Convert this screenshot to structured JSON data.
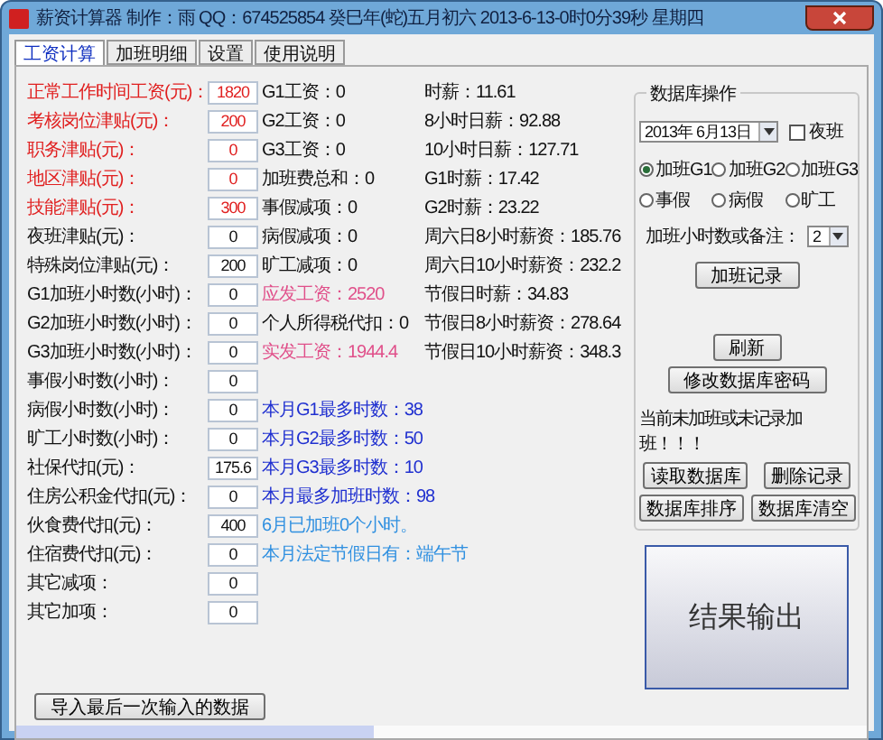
{
  "window": {
    "title": "薪资计算器  制作：雨 QQ：674525854    癸巳年(蛇)五月初六 2013-6-13-0时0分39秒    星期四"
  },
  "tabs": [
    {
      "label": "工资计算",
      "selected": true
    },
    {
      "label": "加班明细",
      "selected": false
    },
    {
      "label": "设置",
      "selected": false
    },
    {
      "label": "使用说明",
      "selected": false
    }
  ],
  "inputs": [
    {
      "label": "正常工作时间工资(元)：",
      "value": "1820",
      "kind": "required"
    },
    {
      "label": "考核岗位津贴(元)：",
      "value": "200",
      "kind": "required"
    },
    {
      "label": "职务津贴(元)：",
      "value": "0",
      "kind": "required"
    },
    {
      "label": "地区津贴(元)：",
      "value": "0",
      "kind": "required"
    },
    {
      "label": "技能津贴(元)：",
      "value": "300",
      "kind": "required"
    },
    {
      "label": "夜班津贴(元)：",
      "value": "0",
      "kind": "normal"
    },
    {
      "label": "特殊岗位津贴(元)：",
      "value": "200",
      "kind": "normal"
    },
    {
      "label": "G1加班小时数(小时)：",
      "value": "0",
      "kind": "normal"
    },
    {
      "label": "G2加班小时数(小时)：",
      "value": "0",
      "kind": "normal"
    },
    {
      "label": "G3加班小时数(小时)：",
      "value": "0",
      "kind": "normal"
    },
    {
      "label": "事假小时数(小时)：",
      "value": "0",
      "kind": "normal"
    },
    {
      "label": "病假小时数(小时)：",
      "value": "0",
      "kind": "normal"
    },
    {
      "label": "旷工小时数(小时)：",
      "value": "0",
      "kind": "normal"
    },
    {
      "label": "社保代扣(元)：",
      "value": "175.6",
      "kind": "normal"
    },
    {
      "label": "住房公积金代扣(元)：",
      "value": "0",
      "kind": "normal"
    },
    {
      "label": "伙食费代扣(元)：",
      "value": "400",
      "kind": "normal"
    },
    {
      "label": "住宿费代扣(元)：",
      "value": "0",
      "kind": "normal"
    },
    {
      "label": "其它减项：",
      "value": "0",
      "kind": "normal"
    },
    {
      "label": "其它加项：",
      "value": "0",
      "kind": "normal"
    }
  ],
  "import_button": "导入最后一次输入的数据",
  "results": [
    {
      "text": "G1工资：0",
      "kind": "normal"
    },
    {
      "text": "G2工资：0",
      "kind": "normal"
    },
    {
      "text": "G3工资：0",
      "kind": "normal"
    },
    {
      "text": "加班费总和：0",
      "kind": "normal"
    },
    {
      "text": "事假减项：0",
      "kind": "normal"
    },
    {
      "text": "病假减项：0",
      "kind": "normal"
    },
    {
      "text": "旷工减项：0",
      "kind": "normal"
    },
    {
      "text": "应发工资：2520",
      "kind": "total"
    },
    {
      "text": "个人所得税代扣：0",
      "kind": "normal"
    },
    {
      "text": "实发工资：1944.4",
      "kind": "total"
    }
  ],
  "month_info": [
    {
      "text": "本月G1最多时数：38",
      "kind": "limit"
    },
    {
      "text": "本月G2最多时数：50",
      "kind": "limit"
    },
    {
      "text": "本月G3最多时数：10",
      "kind": "limit"
    },
    {
      "text": "本月最多加班时数：98",
      "kind": "limit"
    },
    {
      "text": "6月已加班0个小时。",
      "kind": "note"
    },
    {
      "text": "本月法定节假日有：端午节",
      "kind": "note"
    }
  ],
  "rates": [
    "时薪：11.61",
    "8小时日薪：92.88",
    "10小时日薪：127.71",
    "G1时薪：17.42",
    "G2时薪：23.22",
    "周六日8小时薪资：185.76",
    "周六日10小时薪资：232.2",
    "节假日时薪：34.83",
    "节假日8小时薪资：278.64",
    "节假日10小时薪资：348.3"
  ],
  "database": {
    "title": "数据库操作",
    "date": "2013年 6月13日",
    "night_shift": {
      "label": "夜班",
      "checked": false
    },
    "types": [
      {
        "label": "加班G1",
        "selected": true
      },
      {
        "label": "加班G2",
        "selected": false
      },
      {
        "label": "加班G3",
        "selected": false
      },
      {
        "label": "事假",
        "selected": false
      },
      {
        "label": "病假",
        "selected": false
      },
      {
        "label": "旷工",
        "selected": false
      }
    ],
    "hours_label": "加班小时数或备注：",
    "hours_value": "2",
    "record_button": "加班记录",
    "refresh_button": "刷新",
    "password_button": "修改数据库密码",
    "message": "当前未加班或未记录加班！！！",
    "buttons": [
      "读取数据库",
      "删除记录",
      "数据库排序",
      "数据库清空"
    ]
  },
  "output_button": "结果输出",
  "progress": {
    "level": 0.42
  }
}
